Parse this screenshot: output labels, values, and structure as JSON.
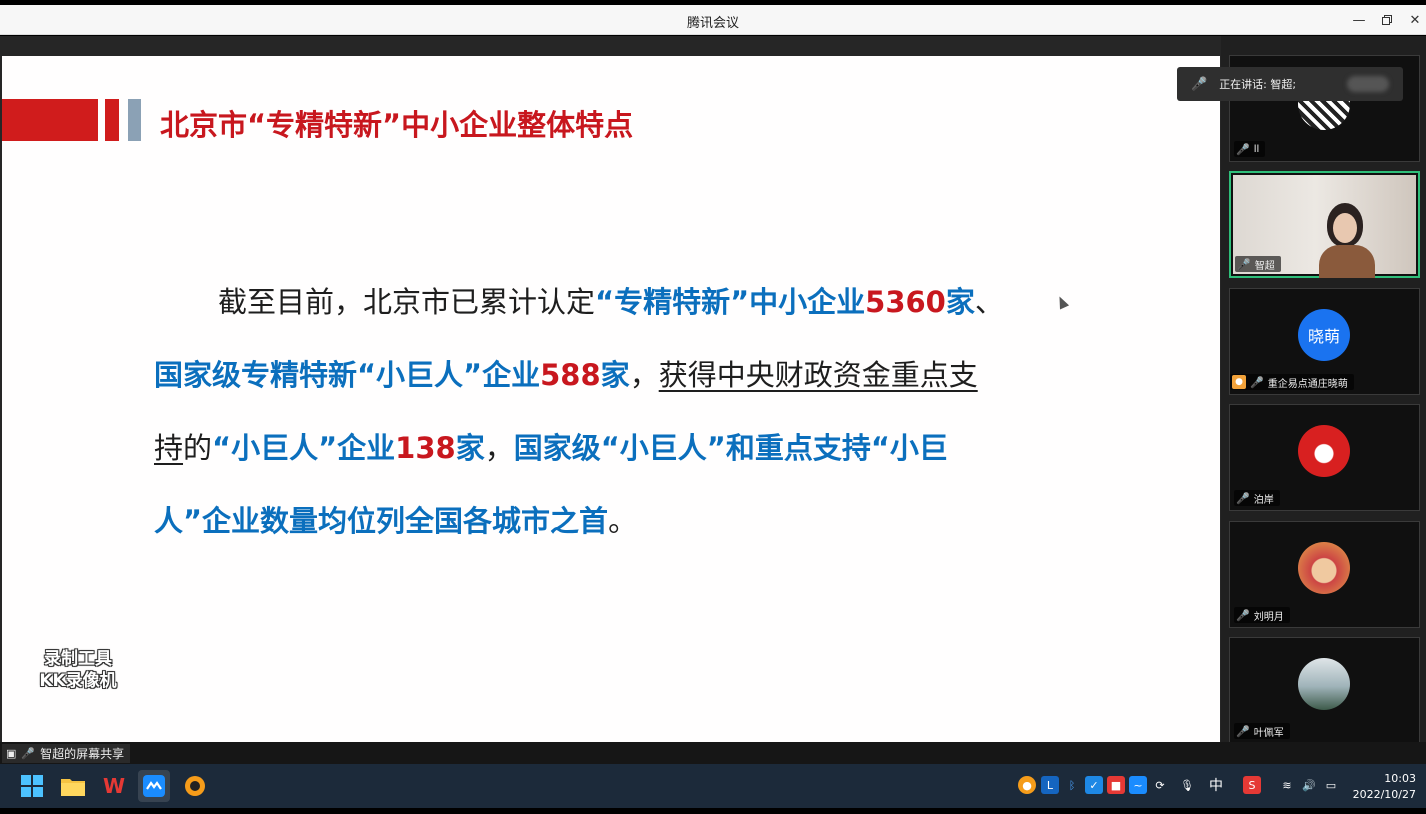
{
  "window": {
    "title": "腾讯会议"
  },
  "slide": {
    "title": "北京市“专精特新”中小企业整体特点",
    "line1": {
      "t1": "截至目前，北京市已累计认定",
      "t2": "“专精特新”中小企业",
      "t3": "5360",
      "t4": "家",
      "t5": "、"
    },
    "line2": {
      "t1": "国家级专精特新“小巨人”企业",
      "t2": "588",
      "t3": "家",
      "t4": "，",
      "t5": "获得中央财政资金重点支"
    },
    "line3": {
      "t1": "持",
      "t2": "的",
      "t3": "“小巨人”企业",
      "t4": "138",
      "t5": "家",
      "t6": "，",
      "t7": "国家级“小巨人”和重点支持“小巨"
    },
    "line4": {
      "t1": "人”企业数量均位列全国各城市之首",
      "t2": "。"
    },
    "watermark_line1": "录制工具",
    "watermark_line2": "KK录像机"
  },
  "speaking_indicator": "正在讲话: 智超;",
  "participants": [
    {
      "name": "ll",
      "muted": true
    },
    {
      "name": "智超",
      "muted": false
    },
    {
      "name": "重企易点通庄晓萌",
      "avatar_text": "晓萌",
      "muted": true
    },
    {
      "name": "泊岸",
      "muted": true
    },
    {
      "name": "刘明月",
      "muted": true
    },
    {
      "name": "叶佩军",
      "muted": true
    }
  ],
  "share_label": "智超的屏幕共享",
  "taskbar": {
    "ime": "中",
    "time": "10:03",
    "date": "2022/10/27"
  },
  "colors": {
    "accent_red": "#c8171e",
    "accent_blue": "#0b6fbd",
    "active_border": "#2fbf7a"
  }
}
